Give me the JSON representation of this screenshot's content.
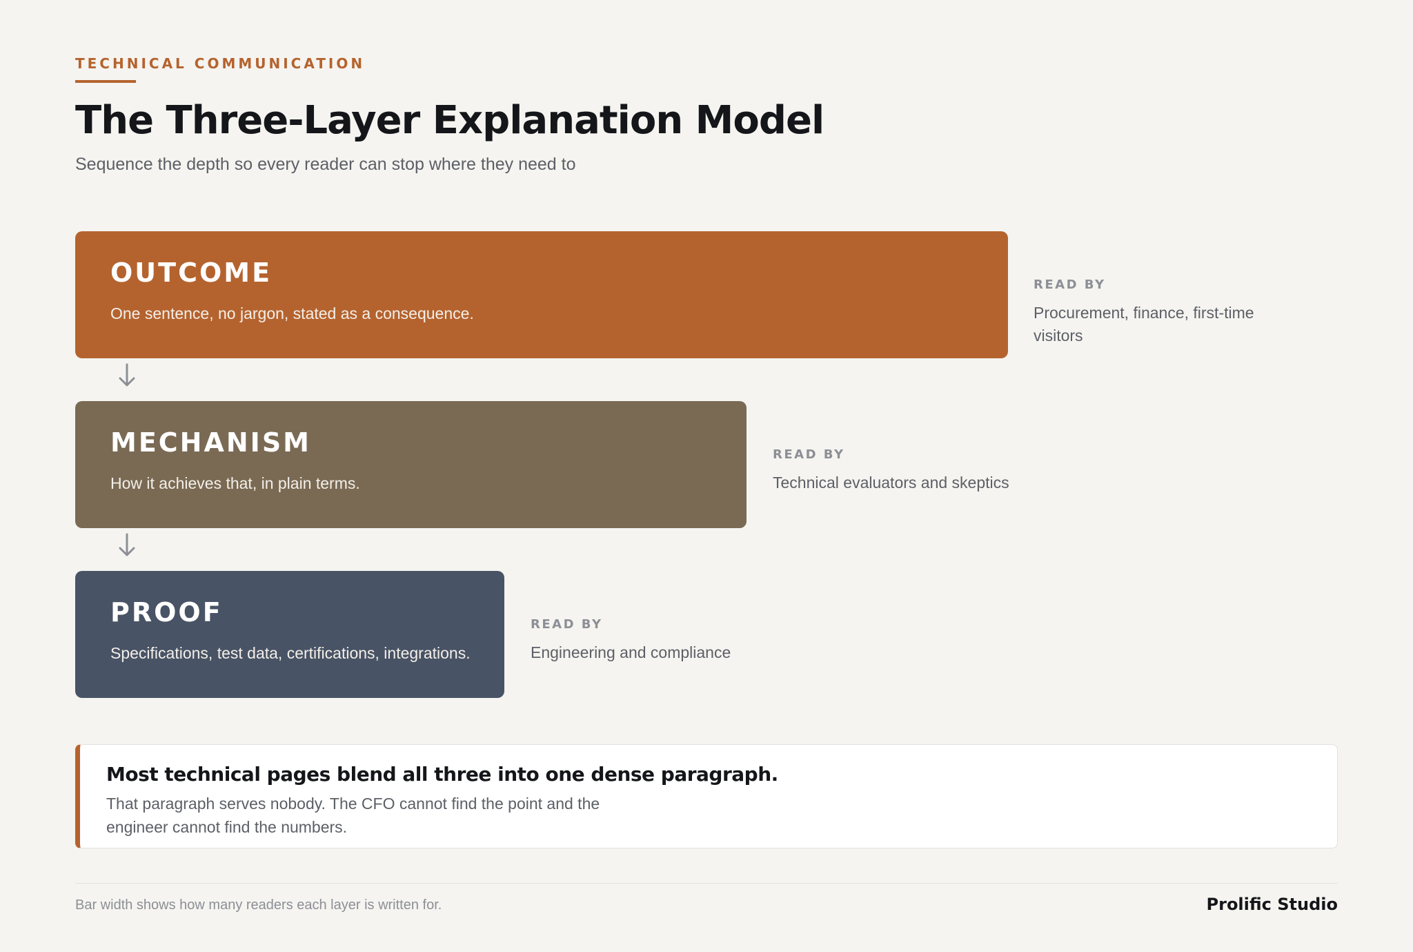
{
  "header": {
    "eyebrow": "TECHNICAL COMMUNICATION",
    "title": "The Three-Layer Explanation Model",
    "subtitle": "Sequence the depth so every reader can stop where they need to"
  },
  "layers": [
    {
      "name": "OUTCOME",
      "description": "One sentence, no jargon, stated as a consequence.",
      "read_by_label": "READ BY",
      "read_by": "Procurement, finance, first-time visitors",
      "color": "#b5632e"
    },
    {
      "name": "MECHANISM",
      "description": "How it achieves that, in plain terms.",
      "read_by_label": "READ BY",
      "read_by": "Technical evaluators and skeptics",
      "color": "#7a6a54"
    },
    {
      "name": "PROOF",
      "description": "Specifications, test data, certifications, integrations.",
      "read_by_label": "READ BY",
      "read_by": "Engineering and compliance",
      "color": "#485365"
    }
  ],
  "callout": {
    "headline": "Most technical pages blend all three into one dense paragraph.",
    "body": "That paragraph serves nobody. The CFO cannot find the point and the engineer cannot find the numbers."
  },
  "footer": {
    "note": "Bar width shows how many readers each layer is written for.",
    "brand": "Prolific Studio"
  }
}
